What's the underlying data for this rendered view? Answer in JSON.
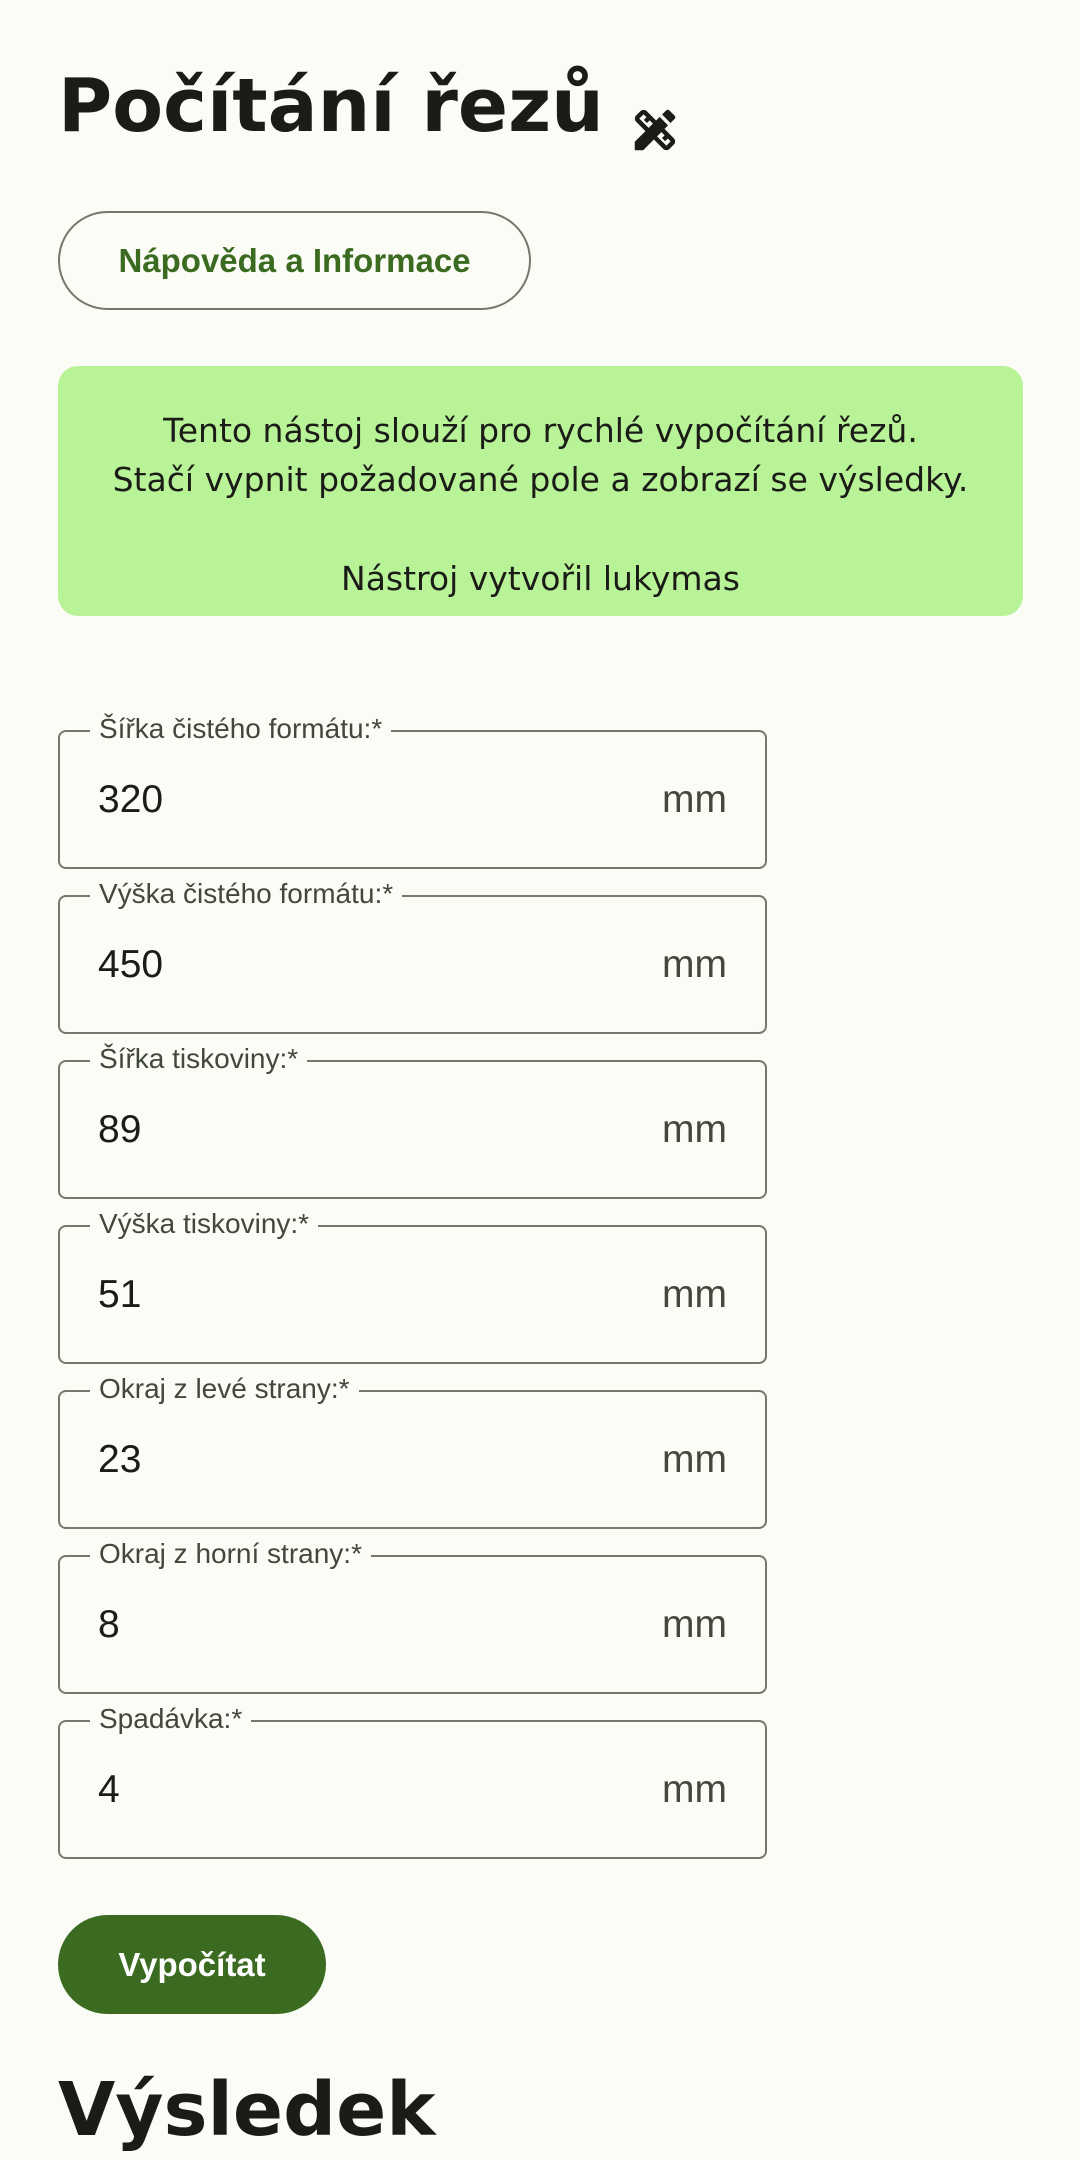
{
  "page": {
    "title": "Počítání řezů",
    "title_icon": "design-services-icon"
  },
  "help_button": {
    "label": "Nápověda a Informace"
  },
  "info_card": {
    "line1": "Tento nástoj slouží pro rychlé vypočítání řezů.",
    "line2": "Stačí vypnit požadované pole a zobrazí se výsledky.",
    "line3": "Nástroj vytvořil lukymas"
  },
  "fields": [
    {
      "label": "Šířka čistého formátu:*",
      "value": "320",
      "unit": "mm"
    },
    {
      "label": "Výška čistého formátu:*",
      "value": "450",
      "unit": "mm"
    },
    {
      "label": "Šířka tiskoviny:*",
      "value": "89",
      "unit": "mm"
    },
    {
      "label": "Výška tiskoviny:*",
      "value": "51",
      "unit": "mm"
    },
    {
      "label": "Okraj z levé strany:*",
      "value": "23",
      "unit": "mm"
    },
    {
      "label": "Okraj z horní strany:*",
      "value": "8",
      "unit": "mm"
    },
    {
      "label": "Spadávka:*",
      "value": "4",
      "unit": "mm"
    }
  ],
  "calc_button": {
    "label": "Vypočítat"
  },
  "results": {
    "heading": "Výsledek"
  },
  "colors": {
    "background": "#fcfcf6",
    "primary": "#3a6b21",
    "info_card": "#b9f397",
    "outline": "#74796d"
  }
}
